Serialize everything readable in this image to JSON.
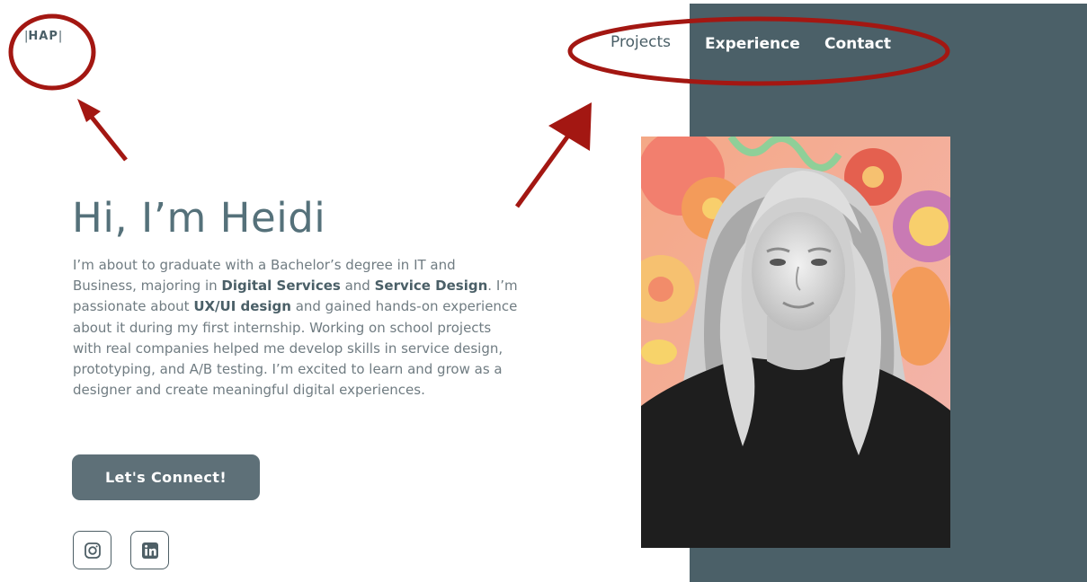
{
  "colors": {
    "panel": "#4b6068",
    "accent_text": "#55717a",
    "button": "#5e7078",
    "annotation": "#a31712"
  },
  "header": {
    "logo_text": "HAP",
    "nav": [
      {
        "label": "Projects"
      },
      {
        "label": "Experience"
      },
      {
        "label": "Contact"
      }
    ]
  },
  "hero": {
    "title": "Hi, I’m Heidi",
    "intro": {
      "t1": "I’m about to graduate with a Bachelor’s degree in IT and Business, majoring in ",
      "b1": "Digital Services",
      "t2": " and ",
      "b2": "Service Design",
      "t3": ". I’m passionate about ",
      "b3": "UX/UI design",
      "t4": " and gained hands-on experience about it during my first internship. Working on school projects with real companies helped me develop skills in service design, prototyping, and A/B testing. I’m excited to learn and grow as a designer and create meaningful digital experiences."
    },
    "cta_label": "Let's Connect!"
  },
  "social": [
    {
      "icon": "instagram-icon"
    },
    {
      "icon": "linkedin-icon"
    }
  ],
  "photo": {
    "description_icon": "profile-photo"
  }
}
